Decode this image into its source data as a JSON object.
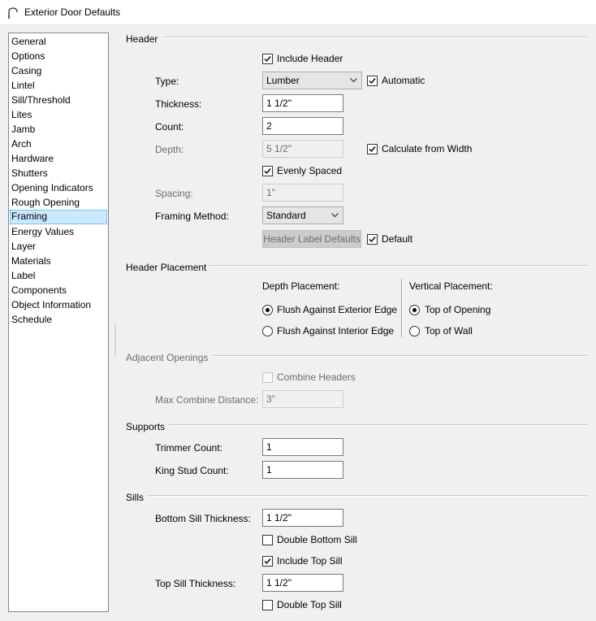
{
  "window": {
    "title": "Exterior Door Defaults",
    "icon": "arch-icon"
  },
  "nav": {
    "items": [
      "General",
      "Options",
      "Casing",
      "Lintel",
      "Sill/Threshold",
      "Lites",
      "Jamb",
      "Arch",
      "Hardware",
      "Shutters",
      "Opening Indicators",
      "Rough Opening",
      "Framing",
      "Energy Values",
      "Layer",
      "Materials",
      "Label",
      "Components",
      "Object Information",
      "Schedule"
    ],
    "selected": "Framing"
  },
  "header": {
    "title": "Header",
    "include_header": {
      "label": "Include Header",
      "checked": true
    },
    "type": {
      "label": "Type:",
      "value": "Lumber"
    },
    "automatic": {
      "label": "Automatic",
      "checked": true
    },
    "thickness": {
      "label": "Thickness:",
      "value": "1 1/2\""
    },
    "count": {
      "label": "Count:",
      "value": "2"
    },
    "depth": {
      "label": "Depth:",
      "value": "5 1/2\""
    },
    "calc_from_width": {
      "label": "Calculate from Width",
      "checked": true
    },
    "evenly_spaced": {
      "label": "Evenly Spaced",
      "checked": true
    },
    "spacing": {
      "label": "Spacing:",
      "value": "1\""
    },
    "framing_method": {
      "label": "Framing Method:",
      "value": "Standard"
    },
    "label_defaults_button": "Header Label Defaults",
    "default": {
      "label": "Default",
      "checked": true
    }
  },
  "placement": {
    "title": "Header Placement",
    "depth_title": "Depth Placement:",
    "flush_exterior": {
      "label": "Flush Against Exterior Edge",
      "selected": true
    },
    "flush_interior": {
      "label": "Flush Against Interior Edge",
      "selected": false
    },
    "vertical_title": "Vertical Placement:",
    "top_of_opening": {
      "label": "Top of Opening",
      "selected": true
    },
    "top_of_wall": {
      "label": "Top of Wall",
      "selected": false
    }
  },
  "adjacent": {
    "title": "Adjacent Openings",
    "combine_headers": {
      "label": "Combine Headers",
      "checked": false
    },
    "max_distance": {
      "label": "Max Combine Distance:",
      "value": "3\""
    }
  },
  "supports": {
    "title": "Supports",
    "trimmer": {
      "label": "Trimmer Count:",
      "value": "1"
    },
    "king_stud": {
      "label": "King Stud Count:",
      "value": "1"
    }
  },
  "sills": {
    "title": "Sills",
    "bottom_thickness": {
      "label": "Bottom Sill Thickness:",
      "value": "1 1/2\""
    },
    "double_bottom": {
      "label": "Double Bottom Sill",
      "checked": false
    },
    "include_top": {
      "label": "Include Top Sill",
      "checked": true
    },
    "top_thickness": {
      "label": "Top Sill Thickness:",
      "value": "1 1/2\""
    },
    "double_top": {
      "label": "Double Top Sill",
      "checked": false
    }
  }
}
